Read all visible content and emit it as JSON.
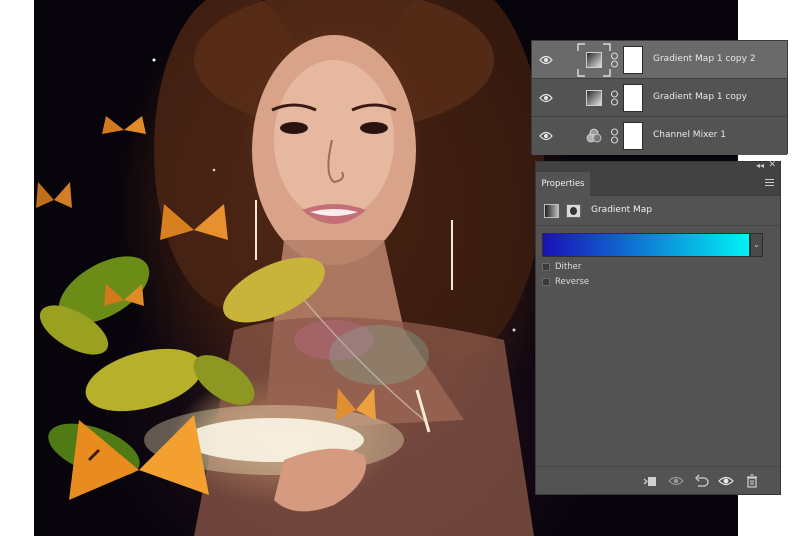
{
  "layers": [
    {
      "name": "Gradient Map 1 copy 2",
      "type": "gradient-map",
      "visible": true,
      "selected": true
    },
    {
      "name": "Gradient Map 1 copy",
      "type": "gradient-map",
      "visible": true,
      "selected": false
    },
    {
      "name": "Channel Mixer 1",
      "type": "channel-mixer",
      "visible": true,
      "selected": false
    }
  ],
  "properties": {
    "tab_label": "Properties",
    "title": "Gradient Map",
    "gradient": {
      "from": "#1a0fb8",
      "to": "#00f2f4"
    },
    "dither": {
      "label": "Dither",
      "checked": false
    },
    "reverse": {
      "label": "Reverse",
      "checked": false
    },
    "collapse_glyph": "◂◂",
    "close_glyph": "✕",
    "dropdown_glyph": "⌄"
  },
  "colors": {
    "panel_bg": "#535353",
    "selected_row": "#6a6a6a",
    "tab_bar": "#424242"
  }
}
